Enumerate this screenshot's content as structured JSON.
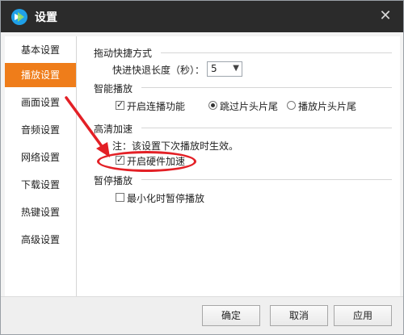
{
  "window": {
    "title": "设置",
    "close_glyph": "✕"
  },
  "sidebar": {
    "items": [
      {
        "label": "基本设置",
        "active": false
      },
      {
        "label": "播放设置",
        "active": true
      },
      {
        "label": "画面设置",
        "active": false
      },
      {
        "label": "音频设置",
        "active": false
      },
      {
        "label": "网络设置",
        "active": false
      },
      {
        "label": "下载设置",
        "active": false
      },
      {
        "label": "热键设置",
        "active": false
      },
      {
        "label": "高级设置",
        "active": false
      }
    ]
  },
  "sections": {
    "drag": {
      "title": "拖动快捷方式",
      "step_label": "快进快退长度（秒）：",
      "step_value": "5"
    },
    "smart": {
      "title": "智能播放",
      "continuous_label": "开启连播功能",
      "continuous_checked": true,
      "skip_label": "跳过片头片尾",
      "skip_selected": true,
      "play_label": "播放片头片尾",
      "play_selected": false
    },
    "hd": {
      "title": "高清加速",
      "note": "注：该设置下次播放时生效。",
      "hw_label": "开启硬件加速",
      "hw_checked": true
    },
    "pause": {
      "title": "暂停播放",
      "minimize_label": "最小化时暂停播放",
      "minimize_checked": false
    }
  },
  "footer": {
    "ok": "确定",
    "cancel": "取消",
    "apply": "应用"
  },
  "colors": {
    "accent": "#ef7d1a",
    "highlight": "#e32026",
    "titlebar": "#2b2b2b"
  }
}
